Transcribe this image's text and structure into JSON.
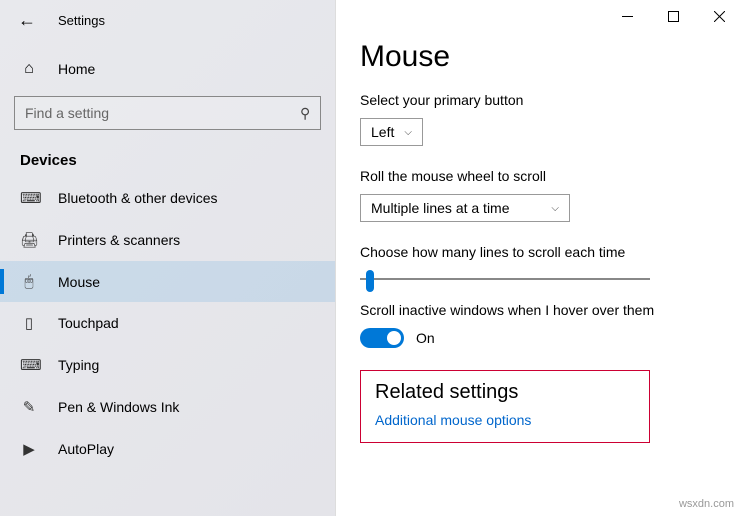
{
  "titlebar": {
    "appName": "Settings"
  },
  "sidebar": {
    "home": "Home",
    "searchPlaceholder": "Find a setting",
    "groupHeader": "Devices",
    "items": [
      {
        "label": "Bluetooth & other devices"
      },
      {
        "label": "Printers & scanners"
      },
      {
        "label": "Mouse"
      },
      {
        "label": "Touchpad"
      },
      {
        "label": "Typing"
      },
      {
        "label": "Pen & Windows Ink"
      },
      {
        "label": "AutoPlay"
      }
    ]
  },
  "main": {
    "title": "Mouse",
    "primaryButton": {
      "label": "Select your primary button",
      "value": "Left"
    },
    "wheelScroll": {
      "label": "Roll the mouse wheel to scroll",
      "value": "Multiple lines at a time"
    },
    "linesPerScroll": {
      "label": "Choose how many lines to scroll each time"
    },
    "hoverScroll": {
      "label": "Scroll inactive windows when I hover over them",
      "state": "On"
    },
    "related": {
      "title": "Related settings",
      "link": "Additional mouse options"
    }
  },
  "watermark": "wsxdn.com"
}
